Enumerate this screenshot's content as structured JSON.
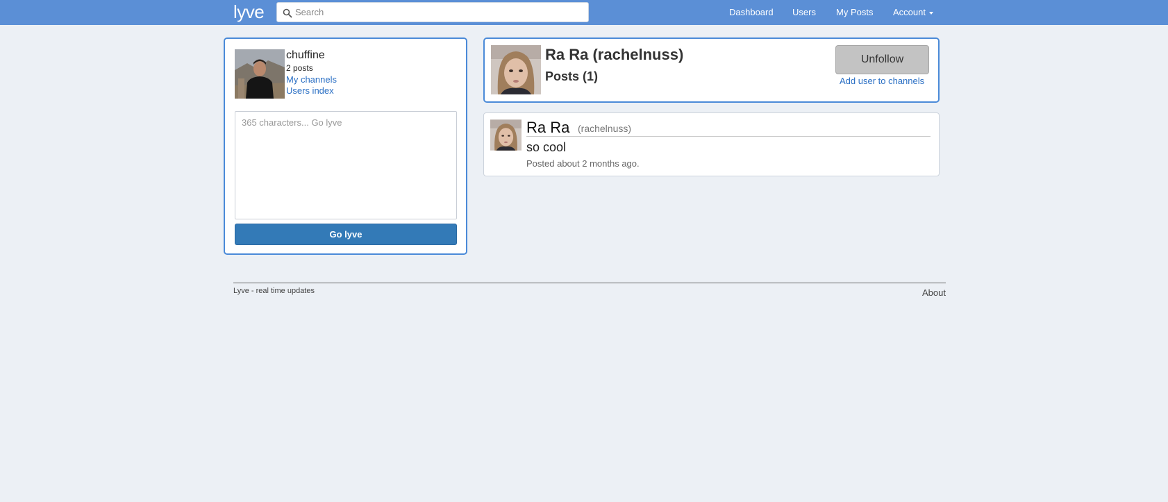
{
  "navbar": {
    "brand": "lyve",
    "search_placeholder": "Search",
    "links": {
      "dashboard": "Dashboard",
      "users": "Users",
      "my_posts": "My Posts",
      "account": "Account"
    },
    "color": "#5b8fd6"
  },
  "sidebar": {
    "username": "chuffine",
    "post_count": "2 posts",
    "my_channels": "My channels",
    "users_index": "Users index",
    "compose_placeholder": "365 characters... Go lyve",
    "submit_label": "Go lyve",
    "avatar_icon": "user-photo"
  },
  "profile": {
    "title": "Ra Ra (rachelnuss)",
    "posts_heading": "Posts (1)",
    "unfollow_label": "Unfollow",
    "add_to_channels": "Add user to channels",
    "avatar_icon": "user-photo"
  },
  "posts": [
    {
      "author": "Ra Ra",
      "handle": "(rachelnuss)",
      "text": "so cool",
      "time": "Posted about 2 months ago."
    }
  ],
  "footer": {
    "tagline": "Lyve - real time updates",
    "about": "About"
  },
  "colors": {
    "accent": "#4a8ad8",
    "primary_button": "#337ab7",
    "background": "#ecf0f5"
  }
}
